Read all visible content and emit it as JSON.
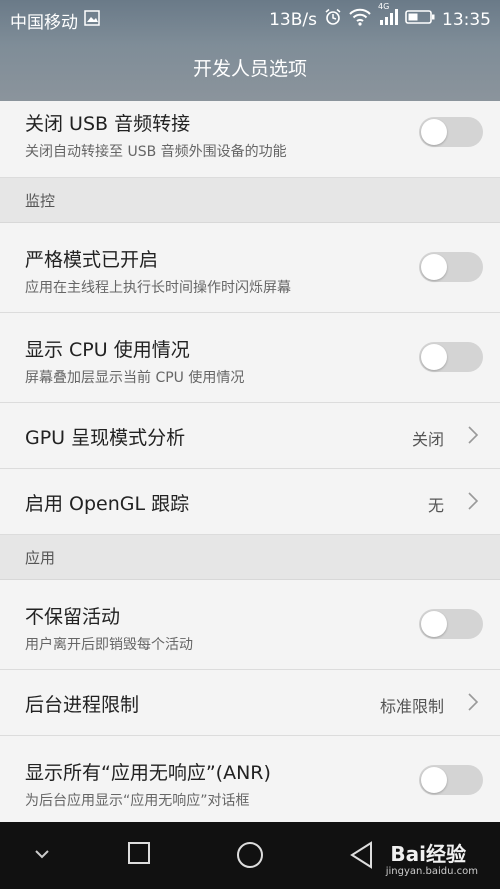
{
  "status_bar": {
    "carrier": "中国移动",
    "net_speed": "13B/s",
    "network_type": "4G",
    "time": "13:35"
  },
  "header": {
    "title": "开发人员选项"
  },
  "rows": {
    "usb_audio": {
      "title": "关闭 USB 音频转接",
      "subtitle": "关闭自动转接至 USB 音频外围设备的功能",
      "enabled": false
    },
    "monitor_section": "监控",
    "strict_mode": {
      "title": "严格模式已开启",
      "subtitle": "应用在主线程上执行长时间操作时闪烁屏幕",
      "enabled": false
    },
    "cpu_usage": {
      "title": "显示 CPU 使用情况",
      "subtitle": "屏幕叠加层显示当前 CPU 使用情况",
      "enabled": false
    },
    "gpu_profile": {
      "title": "GPU 呈现模式分析",
      "value": "关闭"
    },
    "opengl_trace": {
      "title": "启用 OpenGL 跟踪",
      "value": "无"
    },
    "apps_section": "应用",
    "no_keep_activities": {
      "title": "不保留活动",
      "subtitle": "用户离开后即销毁每个活动",
      "enabled": false
    },
    "bg_process_limit": {
      "title": "后台进程限制",
      "value": "标准限制"
    },
    "show_all_anr": {
      "title": "显示所有“应用无响应”(ANR)",
      "subtitle": "为后台应用显示“应用无响应”对话框",
      "enabled": false
    }
  },
  "watermark": {
    "brand": "Bai经验",
    "url": "jingyan.baidu.com"
  },
  "colors": {
    "header_bg": "#7a8894",
    "toggle_off": "#d4d4d4",
    "navbar_bg": "#111111"
  }
}
